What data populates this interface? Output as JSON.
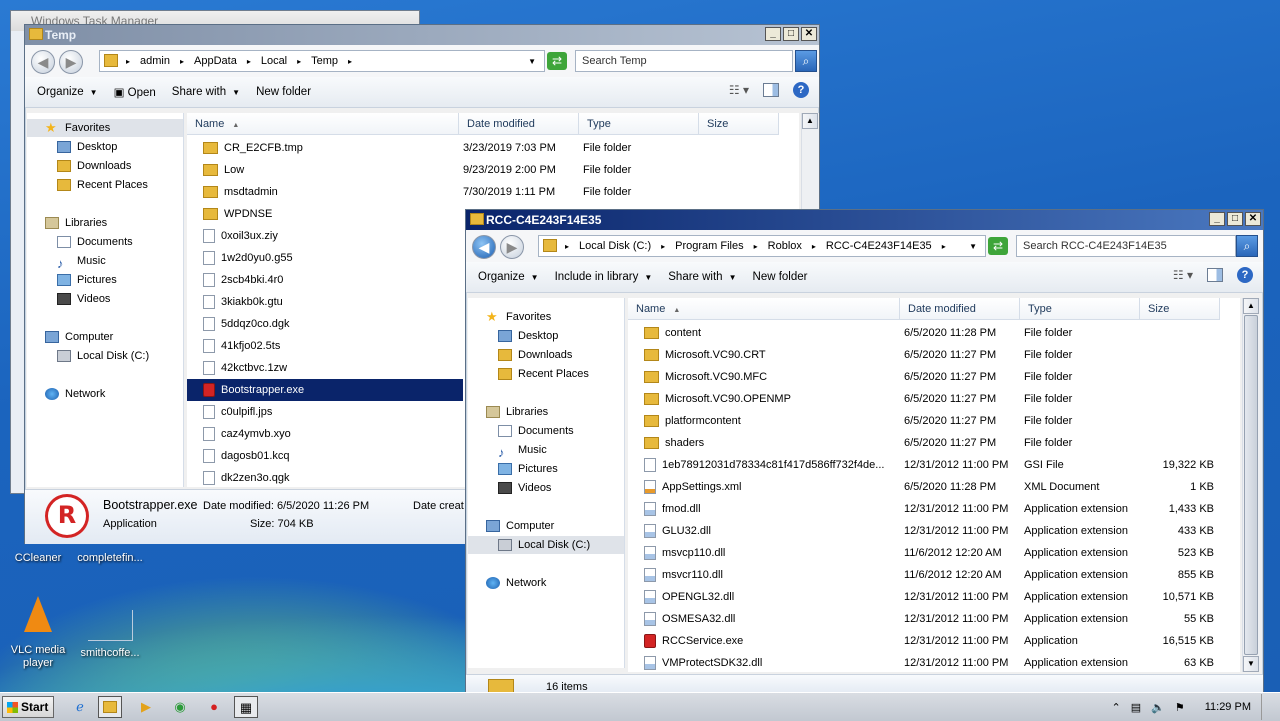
{
  "desktop": {
    "icons": [
      {
        "label": "CCleaner"
      },
      {
        "label": "completefin..."
      },
      {
        "label": "VLC media player"
      },
      {
        "label": "smithcoffe..."
      }
    ]
  },
  "taskmgr": {
    "title": "Windows Task Manager"
  },
  "temp_window": {
    "title": "Temp",
    "breadcrumbs": [
      "admin",
      "AppData",
      "Local",
      "Temp"
    ],
    "search_placeholder": "Search Temp",
    "toolbar": {
      "organize": "Organize",
      "open": "Open",
      "share_with": "Share with",
      "new_folder": "New folder"
    },
    "nav": {
      "favorites": "Favorites",
      "desktop": "Desktop",
      "downloads": "Downloads",
      "recent": "Recent Places",
      "libraries": "Libraries",
      "documents": "Documents",
      "music": "Music",
      "pictures": "Pictures",
      "videos": "Videos",
      "computer": "Computer",
      "local_disk": "Local Disk (C:)",
      "network": "Network"
    },
    "columns": {
      "name": "Name",
      "date": "Date modified",
      "type": "Type",
      "size": "Size"
    },
    "files": [
      {
        "name": "CR_E2CFB.tmp",
        "date": "3/23/2019 7:03 PM",
        "type": "File folder",
        "icon": "folder"
      },
      {
        "name": "Low",
        "date": "9/23/2019 2:00 PM",
        "type": "File folder",
        "icon": "folder"
      },
      {
        "name": "msdtadmin",
        "date": "7/30/2019 1:11 PM",
        "type": "File folder",
        "icon": "folder"
      },
      {
        "name": "WPDNSE",
        "date": "",
        "type": "",
        "icon": "folder"
      },
      {
        "name": "0xoil3ux.ziy",
        "date": "",
        "type": "",
        "icon": "file"
      },
      {
        "name": "1w2d0yu0.g55",
        "date": "",
        "type": "",
        "icon": "file"
      },
      {
        "name": "2scb4bki.4r0",
        "date": "",
        "type": "",
        "icon": "file"
      },
      {
        "name": "3kiakb0k.gtu",
        "date": "",
        "type": "",
        "icon": "file"
      },
      {
        "name": "5ddqz0co.dgk",
        "date": "",
        "type": "",
        "icon": "file"
      },
      {
        "name": "41kfjo02.5ts",
        "date": "",
        "type": "",
        "icon": "file"
      },
      {
        "name": "42kctbvc.1zw",
        "date": "",
        "type": "",
        "icon": "file"
      },
      {
        "name": "Bootstrapper.exe",
        "date": "",
        "type": "",
        "icon": "exe"
      },
      {
        "name": "c0ulpifl.jps",
        "date": "",
        "type": "",
        "icon": "file"
      },
      {
        "name": "caz4ymvb.xyo",
        "date": "",
        "type": "",
        "icon": "file"
      },
      {
        "name": "dagosb01.kcq",
        "date": "",
        "type": "",
        "icon": "file"
      },
      {
        "name": "dk2zen3o.qgk",
        "date": "",
        "type": "",
        "icon": "file"
      }
    ],
    "details": {
      "filename": "Bootstrapper.exe",
      "kind": "Application",
      "date_modified": "Date modified: 6/5/2020 11:26 PM",
      "size": "Size: 704 KB",
      "date_created": "Date creat"
    }
  },
  "rcc_window": {
    "title": "RCC-C4E243F14E35",
    "breadcrumbs": [
      "Local Disk (C:)",
      "Program Files",
      "Roblox",
      "RCC-C4E243F14E35"
    ],
    "search_placeholder": "Search RCC-C4E243F14E35",
    "toolbar": {
      "organize": "Organize",
      "include": "Include in library",
      "share_with": "Share with",
      "new_folder": "New folder"
    },
    "nav": {
      "favorites": "Favorites",
      "desktop": "Desktop",
      "downloads": "Downloads",
      "recent": "Recent Places",
      "libraries": "Libraries",
      "documents": "Documents",
      "music": "Music",
      "pictures": "Pictures",
      "videos": "Videos",
      "computer": "Computer",
      "local_disk": "Local Disk (C:)",
      "network": "Network"
    },
    "columns": {
      "name": "Name",
      "date": "Date modified",
      "type": "Type",
      "size": "Size"
    },
    "files": [
      {
        "name": "content",
        "date": "6/5/2020 11:28 PM",
        "type": "File folder",
        "size": "",
        "icon": "folder"
      },
      {
        "name": "Microsoft.VC90.CRT",
        "date": "6/5/2020 11:27 PM",
        "type": "File folder",
        "size": "",
        "icon": "folder"
      },
      {
        "name": "Microsoft.VC90.MFC",
        "date": "6/5/2020 11:27 PM",
        "type": "File folder",
        "size": "",
        "icon": "folder"
      },
      {
        "name": "Microsoft.VC90.OPENMP",
        "date": "6/5/2020 11:27 PM",
        "type": "File folder",
        "size": "",
        "icon": "folder"
      },
      {
        "name": "platformcontent",
        "date": "6/5/2020 11:27 PM",
        "type": "File folder",
        "size": "",
        "icon": "folder"
      },
      {
        "name": "shaders",
        "date": "6/5/2020 11:27 PM",
        "type": "File folder",
        "size": "",
        "icon": "folder"
      },
      {
        "name": "1eb78912031d78334c81f417d586ff732f4de...",
        "date": "12/31/2012 11:00 PM",
        "type": "GSI File",
        "size": "19,322 KB",
        "icon": "file"
      },
      {
        "name": "AppSettings.xml",
        "date": "6/5/2020 11:28 PM",
        "type": "XML Document",
        "size": "1 KB",
        "icon": "xml"
      },
      {
        "name": "fmod.dll",
        "date": "12/31/2012 11:00 PM",
        "type": "Application extension",
        "size": "1,433 KB",
        "icon": "dll"
      },
      {
        "name": "GLU32.dll",
        "date": "12/31/2012 11:00 PM",
        "type": "Application extension",
        "size": "433 KB",
        "icon": "dll"
      },
      {
        "name": "msvcp110.dll",
        "date": "11/6/2012 12:20 AM",
        "type": "Application extension",
        "size": "523 KB",
        "icon": "dll"
      },
      {
        "name": "msvcr110.dll",
        "date": "11/6/2012 12:20 AM",
        "type": "Application extension",
        "size": "855 KB",
        "icon": "dll"
      },
      {
        "name": "OPENGL32.dll",
        "date": "12/31/2012 11:00 PM",
        "type": "Application extension",
        "size": "10,571 KB",
        "icon": "dll"
      },
      {
        "name": "OSMESA32.dll",
        "date": "12/31/2012 11:00 PM",
        "type": "Application extension",
        "size": "55 KB",
        "icon": "dll"
      },
      {
        "name": "RCCService.exe",
        "date": "12/31/2012 11:00 PM",
        "type": "Application",
        "size": "16,515 KB",
        "icon": "exe"
      },
      {
        "name": "VMProtectSDK32.dll",
        "date": "12/31/2012 11:00 PM",
        "type": "Application extension",
        "size": "63 KB",
        "icon": "dll"
      }
    ],
    "status": "16 items"
  },
  "taskbar": {
    "start": "Start",
    "clock": "11:29 PM"
  }
}
